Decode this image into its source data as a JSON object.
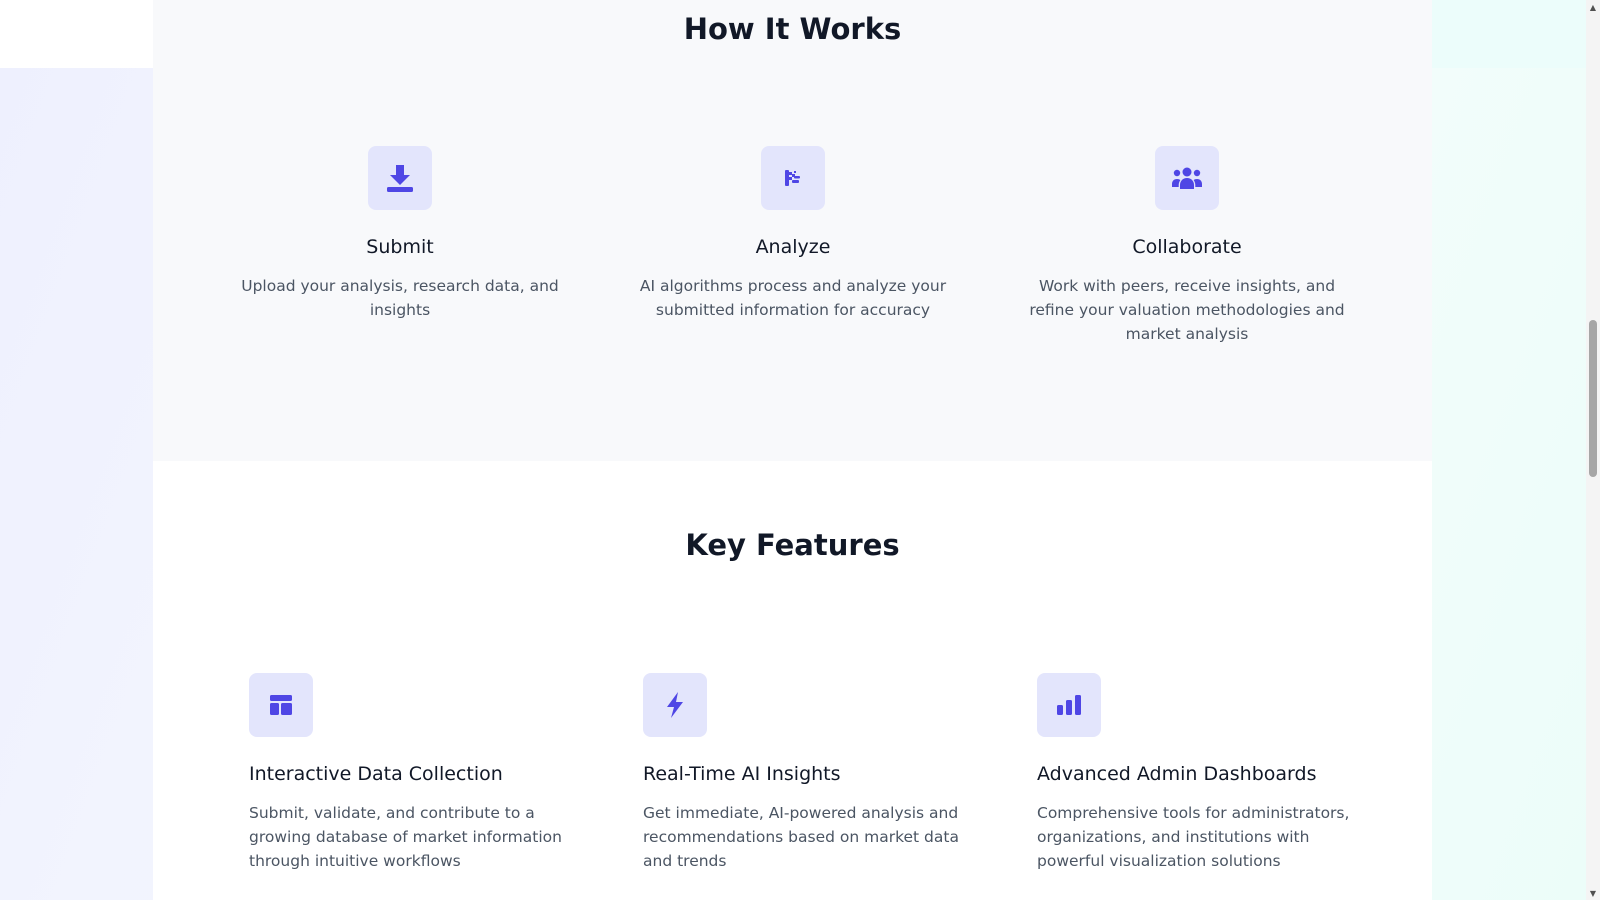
{
  "how_it_works": {
    "title": "How It Works",
    "steps": [
      {
        "title": "Submit",
        "description": "Upload your analysis, research data, and insights",
        "icon": "download-icon"
      },
      {
        "title": "Analyze",
        "description": "AI algorithms process and analyze your submitted information for accuracy",
        "icon": "brain-icon"
      },
      {
        "title": "Collaborate",
        "description": "Work with peers, receive insights, and refine your valuation methodologies and market analysis",
        "icon": "people-group-icon"
      }
    ]
  },
  "key_features": {
    "title": "Key Features",
    "features": [
      {
        "title": "Interactive Data Collection",
        "description": "Submit, validate, and contribute to a growing database of market information through intuitive workflows",
        "icon": "table-layout-icon"
      },
      {
        "title": "Real-Time AI Insights",
        "description": "Get immediate, AI-powered analysis and recommendations based on market data and trends",
        "icon": "lightning-bolt-icon"
      },
      {
        "title": "Advanced Admin Dashboards",
        "description": "Comprehensive tools for administrators, organizations, and institutions with powerful visualization solutions",
        "icon": "bar-chart-icon"
      }
    ]
  },
  "colors": {
    "accent": "#4f46e5",
    "icon_background": "#e3e5fc",
    "heading": "#111827",
    "body_text": "#4b5563"
  }
}
